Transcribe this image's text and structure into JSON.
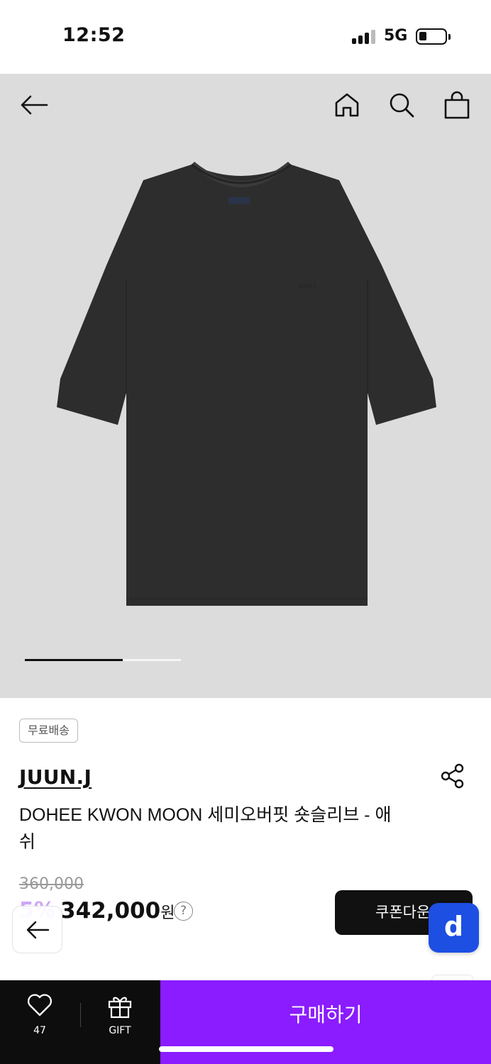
{
  "status_bar": {
    "time": "12:52",
    "network": "5G",
    "signal_icon": "cellular-signal-icon",
    "battery_icon": "battery-icon"
  },
  "header": {
    "icons": [
      "back-arrow-icon",
      "home-icon",
      "search-icon",
      "shopping-bag-icon"
    ]
  },
  "gallery": {
    "current_index": 1,
    "total": 3,
    "progress_fraction": 0.625,
    "shirt_color": "#2d2d2d",
    "background_color": "#dcdcdc"
  },
  "product": {
    "badge": "무료배송",
    "brand": "JUUN.J",
    "title": "DOHEE KWON MOON 세미오버핏 숏슬리브 - 애쉬",
    "original_price": "360,000",
    "discount": "5%",
    "price": "342,000",
    "currency": "원",
    "help_symbol": "?",
    "coupon_label": "쿠폰다운로드",
    "app_badge": "d"
  },
  "bottom_bar": {
    "like_count": "47",
    "gift_label": "GIFT",
    "buy_label": "구매하기",
    "buy_color": "#8a1cff"
  }
}
